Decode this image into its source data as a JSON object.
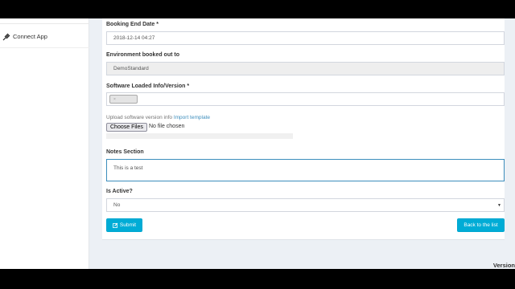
{
  "sidebar": {
    "items": [
      {
        "label": "Connect App",
        "icon": "plug-icon"
      }
    ]
  },
  "form": {
    "booking_end_date": {
      "label": "Booking End Date *",
      "value": "2018-12-14 04:27"
    },
    "environment": {
      "label": "Environment booked out to",
      "value": "DemoStandard"
    },
    "software": {
      "label": "Software Loaded Info/Version *",
      "tag_remove": "×"
    },
    "upload": {
      "help_text": "Upload software version info",
      "link_text": "Import template",
      "button_label": "Choose Files",
      "no_file_text": "No file chosen"
    },
    "notes": {
      "label": "Notes Section",
      "value": "This is a test"
    },
    "is_active": {
      "label": "Is Active?",
      "value": "No",
      "caret": "▼"
    },
    "submit_label": "Submit",
    "back_label": "Back to the list"
  },
  "footer": {
    "version_label": "Version"
  },
  "colors": {
    "accent": "#00acd6",
    "link": "#3c8dbc",
    "page_bg": "#ecf0f5"
  }
}
